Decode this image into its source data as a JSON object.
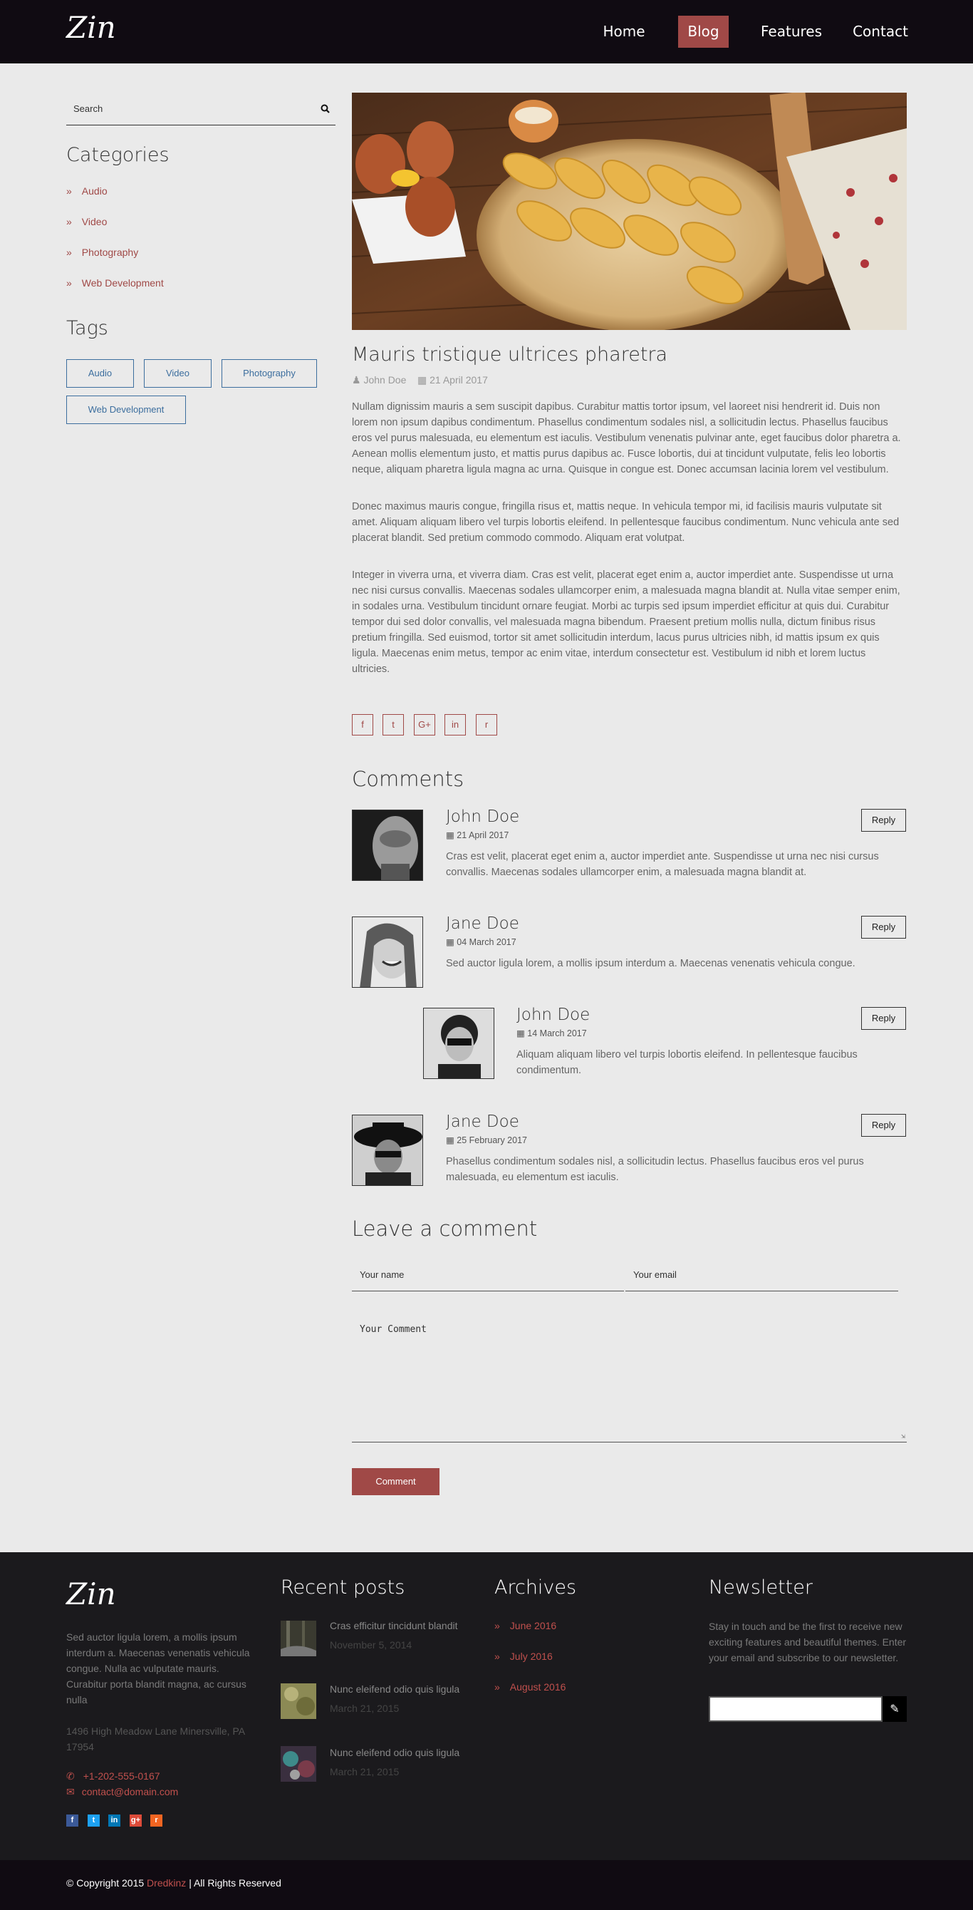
{
  "header": {
    "logo": "Zin",
    "nav": [
      "Home",
      "Blog",
      "Features",
      "Contact"
    ],
    "active_nav": "Blog"
  },
  "sidebar": {
    "search_placeholder": "Search",
    "categories_title": "Categories",
    "categories": [
      "Audio",
      "Video",
      "Photography",
      "Web Development"
    ],
    "tags_title": "Tags",
    "tags": [
      "Audio",
      "Video",
      "Photography",
      "Web Development"
    ]
  },
  "post": {
    "title": "Mauris tristique ultrices pharetra",
    "author": "John Doe",
    "date": "21 April 2017",
    "paragraphs": [
      "Nullam dignissim mauris a sem suscipit dapibus. Curabitur mattis tortor ipsum, vel laoreet nisi hendrerit id. Duis non lorem non ipsum dapibus condimentum. Phasellus condimentum sodales nisl, a sollicitudin lectus. Phasellus faucibus eros vel purus malesuada, eu elementum est iaculis. Vestibulum venenatis pulvinar ante, eget faucibus dolor pharetra a. Aenean mollis elementum justo, et mattis purus dapibus ac. Fusce lobortis, dui at tincidunt vulputate, felis leo lobortis neque, aliquam pharetra ligula magna ac urna. Quisque in congue est. Donec accumsan lacinia lorem vel vestibulum.",
      "Donec maximus mauris congue, fringilla risus et, mattis neque. In vehicula tempor mi, id facilisis mauris vulputate sit amet. Aliquam aliquam libero vel turpis lobortis eleifend. In pellentesque faucibus condimentum. Nunc vehicula ante sed placerat blandit. Sed pretium commodo commodo. Aliquam erat volutpat.",
      "Integer in viverra urna, et viverra diam. Cras est velit, placerat eget enim a, auctor imperdiet ante. Suspendisse ut urna nec nisi cursus convallis. Maecenas sodales ullamcorper enim, a malesuada magna blandit at. Nulla vitae semper enim, in sodales urna. Vestibulum tincidunt ornare feugiat. Morbi ac turpis sed ipsum imperdiet efficitur at quis dui. Curabitur tempor dui sed dolor convallis, vel malesuada magna bibendum. Praesent pretium mollis nulla, dictum finibus risus pretium fringilla. Sed euismod, tortor sit amet sollicitudin interdum, lacus purus ultricies nibh, id mattis ipsum ex quis ligula. Maecenas enim metus, tempor ac enim vitae, interdum consectetur est. Vestibulum id nibh et lorem luctus ultricies."
    ],
    "share_icons": [
      "facebook-icon",
      "twitter-icon",
      "google-plus-icon",
      "linkedin-icon",
      "rss-icon"
    ],
    "share_glyphs": [
      "f",
      "t",
      "G+",
      "in",
      "r"
    ]
  },
  "comments": {
    "title": "Comments",
    "reply_label": "Reply",
    "items": [
      {
        "name": "John Doe",
        "date": "21 April 2017",
        "text": "Cras est velit, placerat eget enim a, auctor imperdiet ante. Suspendisse ut urna nec nisi cursus convallis. Maecenas sodales ullamcorper enim, a malesuada magna blandit at."
      },
      {
        "name": "Jane Doe",
        "date": "04 March 2017",
        "text": "Sed auctor ligula lorem, a mollis ipsum interdum a. Maecenas venenatis vehicula congue."
      },
      {
        "name": "John Doe",
        "date": "14 March 2017",
        "text": "Aliquam aliquam libero vel turpis lobortis eleifend. In pellentesque faucibus condimentum."
      },
      {
        "name": "Jane Doe",
        "date": "25 February 2017",
        "text": "Phasellus condimentum sodales nisl, a sollicitudin lectus. Phasellus faucibus eros vel purus malesuada, eu elementum est iaculis."
      }
    ]
  },
  "comment_form": {
    "title": "Leave a comment",
    "name_placeholder": "Your name",
    "email_placeholder": "Your email",
    "comment_placeholder": "Your Comment",
    "submit_label": "Comment"
  },
  "footer": {
    "logo": "Zin",
    "about": "Sed auctor ligula lorem, a mollis ipsum interdum a. Maecenas venenatis vehicula congue. Nulla ac vulputate mauris. Curabitur porta blandit magna, ac cursus nulla",
    "address": "1496 High Meadow Lane Minersville, PA 17954",
    "phone": "+1-202-555-0167",
    "email": "contact@domain.com",
    "social_icons": [
      "facebook-icon",
      "twitter-icon",
      "linkedin-icon",
      "google-plus-icon",
      "rss-icon"
    ],
    "social_glyphs": [
      "f",
      "t",
      "in",
      "g+",
      "r"
    ],
    "social_colors": [
      "#3b5998",
      "#1da1f2",
      "#0077b5",
      "#dd4b39",
      "#f26522"
    ],
    "recent_title": "Recent posts",
    "recent_posts": [
      {
        "title": "Cras efficitur tincidunt blandit",
        "date": "November 5, 2014"
      },
      {
        "title": "Nunc eleifend odio quis ligula",
        "date": "March 21, 2015"
      },
      {
        "title": "Nunc eleifend odio quis ligula",
        "date": "March 21, 2015"
      }
    ],
    "archives_title": "Archives",
    "archives": [
      "June 2016",
      "July 2016",
      "August 2016"
    ],
    "newsletter_title": "Newsletter",
    "newsletter_text": "Stay in touch and be the first to receive new exciting features and beautiful themes. Enter your email and subscribe to our newsletter.",
    "copyright_prefix": "© Copyright 2015",
    "copyright_brand": "Dredkinz",
    "copyright_suffix": "| All Rights Reserved"
  },
  "colors": {
    "accent": "#a04947",
    "header_bg": "#100b12",
    "footer_bg": "#1b1a1d",
    "tag": "#3c6e9e"
  }
}
